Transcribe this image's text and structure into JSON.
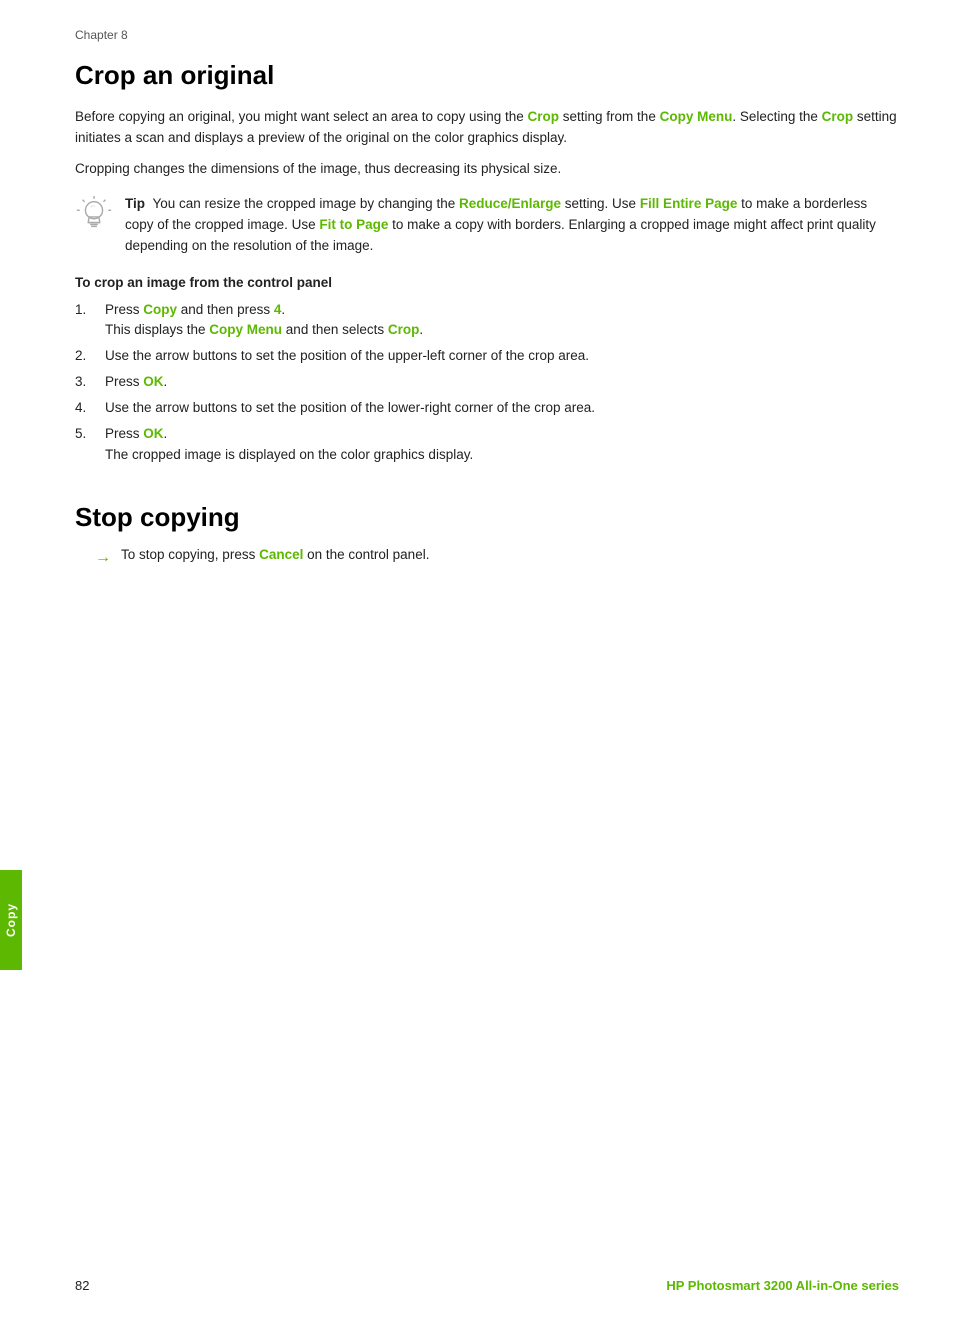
{
  "page": {
    "chapter_label": "Chapter 8",
    "footer_page": "82",
    "footer_product": "HP Photosmart 3200 All-in-One series"
  },
  "side_tab": {
    "label": "Copy"
  },
  "crop_section": {
    "title": "Crop an original",
    "para1_parts": [
      "Before copying an original, you might want select an area to copy using the ",
      "Crop",
      " setting from the ",
      "Copy Menu",
      ". Selecting the ",
      "Crop",
      " setting initiates a scan and displays a preview of the original on the color graphics display."
    ],
    "para2": "Cropping changes the dimensions of the image, thus decreasing its physical size.",
    "tip_label": "Tip",
    "tip_parts": [
      "You can resize the cropped image by changing the ",
      "Reduce/Enlarge",
      " setting. Use ",
      "Fill Entire Page",
      " to make a borderless copy of the cropped image. Use ",
      "Fit to Page",
      " to make a copy with borders. Enlarging a cropped image might affect print quality depending on the resolution of the image."
    ],
    "sub_heading": "To crop an image from the control panel",
    "steps": [
      {
        "num": "1.",
        "text_parts": [
          "Press ",
          "Copy",
          " and then press ",
          "4",
          "."
        ],
        "sub_parts": [
          "This displays the ",
          "Copy Menu",
          " and then selects ",
          "Crop",
          "."
        ]
      },
      {
        "num": "2.",
        "text_parts": [
          "Use the arrow buttons to set the position of the upper-left corner of the crop area."
        ]
      },
      {
        "num": "3.",
        "text_parts": [
          "Press ",
          "OK",
          "."
        ]
      },
      {
        "num": "4.",
        "text_parts": [
          "Use the arrow buttons to set the position of the lower-right corner of the crop area."
        ]
      },
      {
        "num": "5.",
        "text_parts": [
          "Press ",
          "OK",
          "."
        ],
        "sub_parts": [
          "The cropped image is displayed on the color graphics display."
        ]
      }
    ]
  },
  "stop_section": {
    "title": "Stop copying",
    "arrow_parts": [
      "To stop copying, press ",
      "Cancel",
      " on the control panel."
    ]
  }
}
